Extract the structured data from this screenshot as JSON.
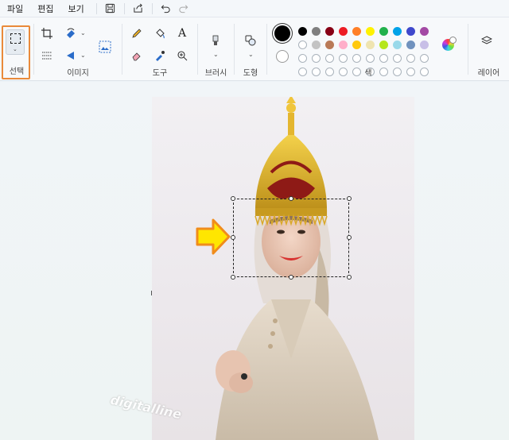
{
  "menu": {
    "items": [
      "파일",
      "편집",
      "보기"
    ]
  },
  "quick_access": {
    "icons": [
      "save-icon",
      "share-icon",
      "undo-icon",
      "redo-icon"
    ]
  },
  "ribbon": {
    "groups": {
      "select": {
        "label": "선택"
      },
      "image": {
        "label": "이미지"
      },
      "tools": {
        "label": "도구"
      },
      "brushes": {
        "label": "브러시"
      },
      "shapes": {
        "label": "도형"
      },
      "colors": {
        "label": "색"
      },
      "layers": {
        "label": "레이어"
      }
    },
    "text_tool": "A"
  },
  "colors": {
    "primary": "#000000",
    "secondary": "#ffffff",
    "row1": [
      "#000000",
      "#7f7f7f",
      "#880015",
      "#ed1c24",
      "#ff7f27",
      "#fff200",
      "#22b14c",
      "#00a2e8",
      "#3f48cc",
      "#a349a4"
    ],
    "row2": [
      "#ffffff",
      "#c3c3c3",
      "#b97a57",
      "#ffaec9",
      "#ffc90e",
      "#efe4b0",
      "#b5e61d",
      "#99d9ea",
      "#7092be",
      "#c8bfe7"
    ],
    "highlight": "#e98a3a",
    "arrow": "#ffe600"
  },
  "canvas": {
    "watermark": "digitalline"
  }
}
